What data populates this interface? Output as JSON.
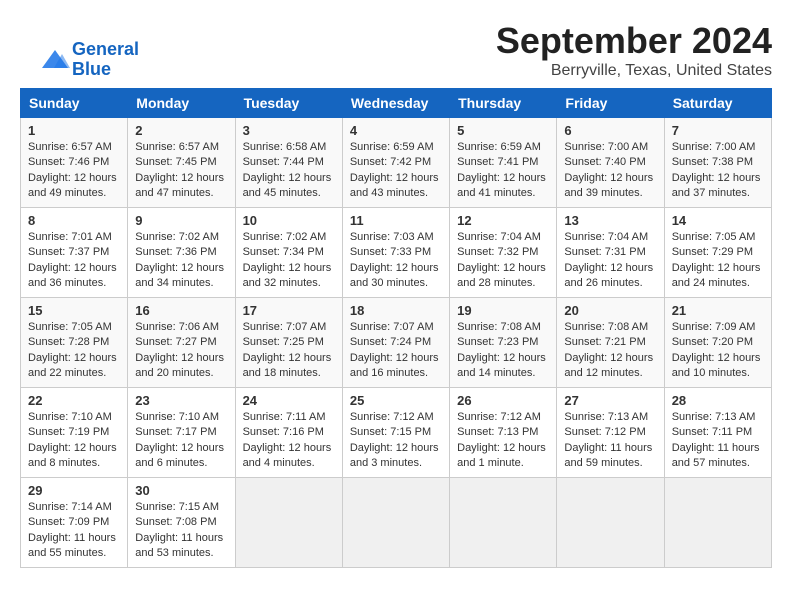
{
  "logo": {
    "line1": "General",
    "line2": "Blue"
  },
  "title": "September 2024",
  "subtitle": "Berryville, Texas, United States",
  "weekdays": [
    "Sunday",
    "Monday",
    "Tuesday",
    "Wednesday",
    "Thursday",
    "Friday",
    "Saturday"
  ],
  "weeks": [
    [
      {
        "day": "1",
        "info": "Sunrise: 6:57 AM\nSunset: 7:46 PM\nDaylight: 12 hours\nand 49 minutes."
      },
      {
        "day": "2",
        "info": "Sunrise: 6:57 AM\nSunset: 7:45 PM\nDaylight: 12 hours\nand 47 minutes."
      },
      {
        "day": "3",
        "info": "Sunrise: 6:58 AM\nSunset: 7:44 PM\nDaylight: 12 hours\nand 45 minutes."
      },
      {
        "day": "4",
        "info": "Sunrise: 6:59 AM\nSunset: 7:42 PM\nDaylight: 12 hours\nand 43 minutes."
      },
      {
        "day": "5",
        "info": "Sunrise: 6:59 AM\nSunset: 7:41 PM\nDaylight: 12 hours\nand 41 minutes."
      },
      {
        "day": "6",
        "info": "Sunrise: 7:00 AM\nSunset: 7:40 PM\nDaylight: 12 hours\nand 39 minutes."
      },
      {
        "day": "7",
        "info": "Sunrise: 7:00 AM\nSunset: 7:38 PM\nDaylight: 12 hours\nand 37 minutes."
      }
    ],
    [
      {
        "day": "8",
        "info": "Sunrise: 7:01 AM\nSunset: 7:37 PM\nDaylight: 12 hours\nand 36 minutes."
      },
      {
        "day": "9",
        "info": "Sunrise: 7:02 AM\nSunset: 7:36 PM\nDaylight: 12 hours\nand 34 minutes."
      },
      {
        "day": "10",
        "info": "Sunrise: 7:02 AM\nSunset: 7:34 PM\nDaylight: 12 hours\nand 32 minutes."
      },
      {
        "day": "11",
        "info": "Sunrise: 7:03 AM\nSunset: 7:33 PM\nDaylight: 12 hours\nand 30 minutes."
      },
      {
        "day": "12",
        "info": "Sunrise: 7:04 AM\nSunset: 7:32 PM\nDaylight: 12 hours\nand 28 minutes."
      },
      {
        "day": "13",
        "info": "Sunrise: 7:04 AM\nSunset: 7:31 PM\nDaylight: 12 hours\nand 26 minutes."
      },
      {
        "day": "14",
        "info": "Sunrise: 7:05 AM\nSunset: 7:29 PM\nDaylight: 12 hours\nand 24 minutes."
      }
    ],
    [
      {
        "day": "15",
        "info": "Sunrise: 7:05 AM\nSunset: 7:28 PM\nDaylight: 12 hours\nand 22 minutes."
      },
      {
        "day": "16",
        "info": "Sunrise: 7:06 AM\nSunset: 7:27 PM\nDaylight: 12 hours\nand 20 minutes."
      },
      {
        "day": "17",
        "info": "Sunrise: 7:07 AM\nSunset: 7:25 PM\nDaylight: 12 hours\nand 18 minutes."
      },
      {
        "day": "18",
        "info": "Sunrise: 7:07 AM\nSunset: 7:24 PM\nDaylight: 12 hours\nand 16 minutes."
      },
      {
        "day": "19",
        "info": "Sunrise: 7:08 AM\nSunset: 7:23 PM\nDaylight: 12 hours\nand 14 minutes."
      },
      {
        "day": "20",
        "info": "Sunrise: 7:08 AM\nSunset: 7:21 PM\nDaylight: 12 hours\nand 12 minutes."
      },
      {
        "day": "21",
        "info": "Sunrise: 7:09 AM\nSunset: 7:20 PM\nDaylight: 12 hours\nand 10 minutes."
      }
    ],
    [
      {
        "day": "22",
        "info": "Sunrise: 7:10 AM\nSunset: 7:19 PM\nDaylight: 12 hours\nand 8 minutes."
      },
      {
        "day": "23",
        "info": "Sunrise: 7:10 AM\nSunset: 7:17 PM\nDaylight: 12 hours\nand 6 minutes."
      },
      {
        "day": "24",
        "info": "Sunrise: 7:11 AM\nSunset: 7:16 PM\nDaylight: 12 hours\nand 4 minutes."
      },
      {
        "day": "25",
        "info": "Sunrise: 7:12 AM\nSunset: 7:15 PM\nDaylight: 12 hours\nand 3 minutes."
      },
      {
        "day": "26",
        "info": "Sunrise: 7:12 AM\nSunset: 7:13 PM\nDaylight: 12 hours\nand 1 minute."
      },
      {
        "day": "27",
        "info": "Sunrise: 7:13 AM\nSunset: 7:12 PM\nDaylight: 11 hours\nand 59 minutes."
      },
      {
        "day": "28",
        "info": "Sunrise: 7:13 AM\nSunset: 7:11 PM\nDaylight: 11 hours\nand 57 minutes."
      }
    ],
    [
      {
        "day": "29",
        "info": "Sunrise: 7:14 AM\nSunset: 7:09 PM\nDaylight: 11 hours\nand 55 minutes."
      },
      {
        "day": "30",
        "info": "Sunrise: 7:15 AM\nSunset: 7:08 PM\nDaylight: 11 hours\nand 53 minutes."
      },
      {
        "day": "",
        "info": ""
      },
      {
        "day": "",
        "info": ""
      },
      {
        "day": "",
        "info": ""
      },
      {
        "day": "",
        "info": ""
      },
      {
        "day": "",
        "info": ""
      }
    ]
  ]
}
